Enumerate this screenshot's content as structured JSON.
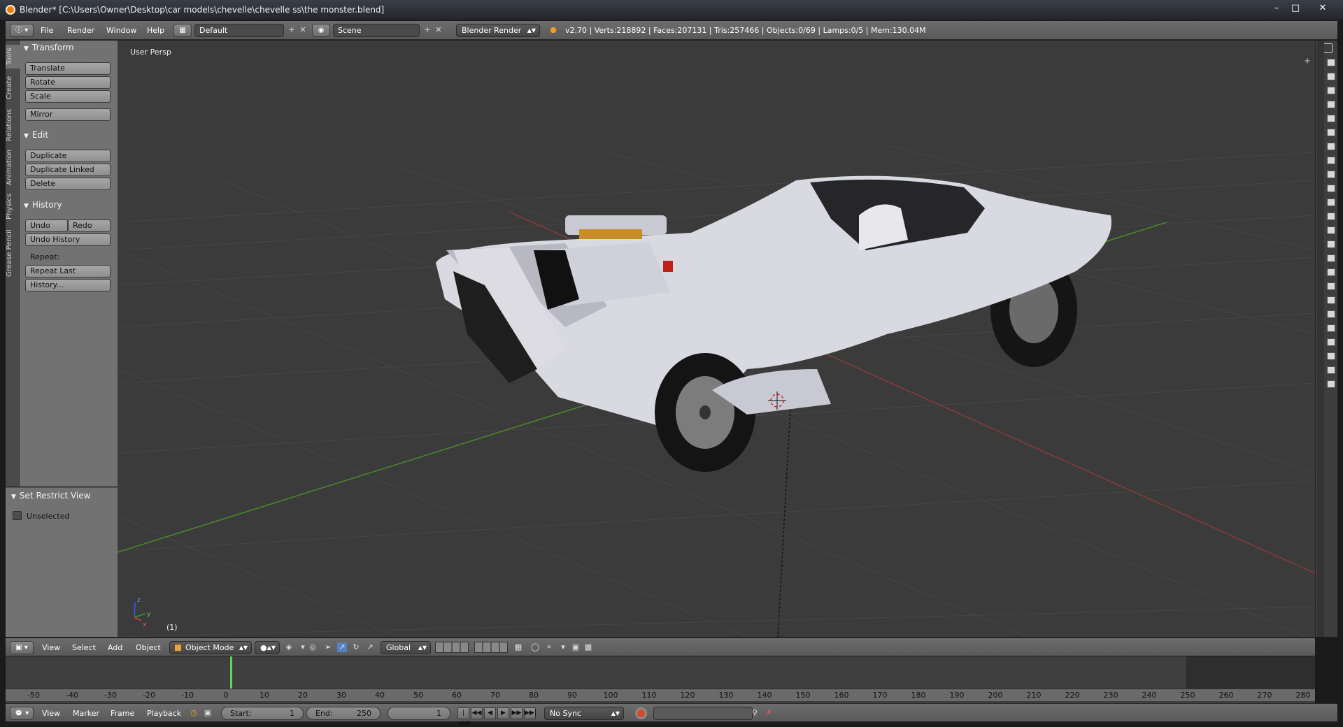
{
  "window": {
    "title": "Blender* [C:\\Users\\Owner\\Desktop\\car models\\chevelle\\chevelle ss\\the monster.blend]",
    "minimize": "–",
    "maximize": "□",
    "close": "✕"
  },
  "info_header": {
    "menus": [
      "File",
      "Render",
      "Window",
      "Help"
    ],
    "screen_layout": "Default",
    "scene": "Scene",
    "render_engine": "Blender Render",
    "stats": "v2.70 | Verts:218892 | Faces:207131 | Tris:257466 | Objects:0/69 | Lamps:0/5 | Mem:130.04M"
  },
  "tool_tabs": [
    "Tools",
    "Create",
    "Relations",
    "Animation",
    "Physics",
    "Grease Pencil"
  ],
  "tool_shelf": {
    "transform": {
      "header": "Transform",
      "buttons": [
        "Translate",
        "Rotate",
        "Scale",
        "Mirror"
      ]
    },
    "edit": {
      "header": "Edit",
      "buttons": [
        "Duplicate",
        "Duplicate Linked",
        "Delete"
      ]
    },
    "history": {
      "header": "History",
      "undo": "Undo",
      "redo": "Redo",
      "undo_history": "Undo History",
      "repeat_label": "Repeat:",
      "repeat_last": "Repeat Last",
      "history": "History..."
    }
  },
  "restrict_view": {
    "header": "Set Restrict View",
    "unselected_label": "Unselected",
    "unselected_checked": false
  },
  "viewport": {
    "view_label": "User Persp",
    "frame_label": "(1)",
    "axis_x": "x",
    "axis_y": "y",
    "axis_z": "z",
    "colors": {
      "background": "#3b3b3b",
      "grid": "#454545",
      "x_axis": "#8a3a3a",
      "y_axis": "#4a8a2a",
      "car_body": "#d9d9e2"
    }
  },
  "view3d_header": {
    "menus": [
      "View",
      "Select",
      "Add",
      "Object"
    ],
    "mode": "Object Mode",
    "orientation": "Global"
  },
  "timeline": {
    "ticks": [
      "-50",
      "-40",
      "-30",
      "-20",
      "-10",
      "0",
      "10",
      "20",
      "30",
      "40",
      "50",
      "60",
      "70",
      "80",
      "90",
      "100",
      "110",
      "120",
      "130",
      "140",
      "150",
      "160",
      "170",
      "180",
      "190",
      "200",
      "210",
      "220",
      "230",
      "240",
      "250",
      "260",
      "270",
      "280"
    ],
    "current_frame": 1,
    "colors": {
      "playhead": "#5fd15f",
      "ruler": "#6a6a6a"
    }
  },
  "timeline_header": {
    "menus": [
      "View",
      "Marker",
      "Frame",
      "Playback"
    ],
    "start_label": "Start:",
    "start_value": "1",
    "end_label": "End:",
    "end_value": "250",
    "current_value": "1",
    "sync": "No Sync"
  }
}
